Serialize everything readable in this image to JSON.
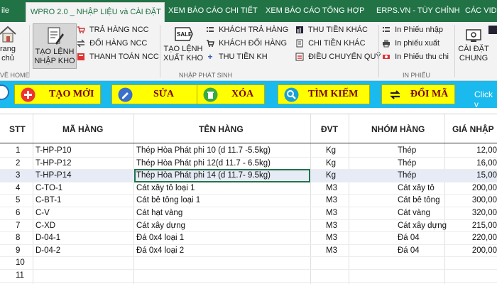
{
  "tabs": [
    {
      "label": "ile"
    },
    {
      "label": "WPRO 2.0 _ NHẬP LIỆU và CÀI ĐẶT",
      "active": true
    },
    {
      "label": "XEM BÁO CÁO CHI TIẾT"
    },
    {
      "label": "XEM BÁO CÁO TỔNG HỢP"
    },
    {
      "label": "ERPS.VN - TÙY CHỈNH"
    },
    {
      "label": "CÁC VID"
    }
  ],
  "ribbon": {
    "home": {
      "label": "rang\nchủ",
      "group": "VỀ HOME"
    },
    "tao_lenh_nhap": {
      "label": "TẠO LỆNH\nNHẬP KHO"
    },
    "tra_hang_ncc": {
      "label": "TRẢ HÀNG NCC"
    },
    "doi_hang_ncc": {
      "label": "ĐỔI HÀNG NCC"
    },
    "thanh_toan_ncc": {
      "label": "THANH TOÁN NCC"
    },
    "tao_lenh_xuat": {
      "label": "TẠO LỆNH\nXUẤT KHO"
    },
    "khach_tra_hang": {
      "label": "KHÁCH TRẢ HÀNG"
    },
    "khach_doi_hang": {
      "label": "KHÁCH ĐỔI HÀNG"
    },
    "thu_tien_kh": {
      "label": "THU TIỀN KH"
    },
    "thu_tien_khac": {
      "label": "THU TIỀN KHÁC"
    },
    "chi_tien_khac": {
      "label": "CHI TIỀN KHÁC"
    },
    "dieu_chuyen_quy": {
      "label": "ĐIỀU CHUYỂN QUỸ"
    },
    "group_nhap_phat_sinh": "NHẬP PHÁT SINH",
    "in_phieu_nhap": {
      "label": "In Phiếu nhập"
    },
    "in_phieu_xuat": {
      "label": "In phiếu xuất"
    },
    "in_phieu_thu_chi": {
      "label": "In Phiếu thu chi"
    },
    "group_in_phieu": "IN PHIẾU",
    "cai_dat_chung": {
      "label": "CÀI ĐẶT\nCHUNG"
    }
  },
  "actions": {
    "tao_moi": "TẠO MỚI",
    "sua": "SỬA",
    "xoa": "XÓA",
    "tim_kiem": "TÌM KIẾM",
    "doi_ma": "ĐỔI MÃ",
    "click_hint": "Click v"
  },
  "table": {
    "headers": {
      "stt": "STT",
      "ma_hang": "MÃ HÀNG",
      "ten_hang": "TÊN HÀNG",
      "dvt": "ĐVT",
      "nhom_hang": "NHÓM HÀNG",
      "gia_nhap": "GIÁ NHẬP"
    },
    "rows": [
      {
        "stt": "1",
        "ma": "T-HP-P10",
        "ten": "Thép Hòa Phát phi 10 (d 11.7 -5.5kg)",
        "dvt": "Kg",
        "nhom": "Thép",
        "gia": "12,00"
      },
      {
        "stt": "2",
        "ma": "T-HP-P12",
        "ten": "Thép Hòa Phát phi 12(d 11.7 - 6.5kg)",
        "dvt": "Kg",
        "nhom": "Thép",
        "gia": "16,00"
      },
      {
        "stt": "3",
        "ma": "T-HP-P14",
        "ten": "Thép Hòa Phát phi 14 (d 11.7- 9.5kg)",
        "dvt": "Kg",
        "nhom": "Thép",
        "gia": "15,00"
      },
      {
        "stt": "4",
        "ma": "C-TO-1",
        "ten": "Cát xây tô loại 1",
        "dvt": "M3",
        "nhom": "Cát xây tô",
        "gia": "200,00"
      },
      {
        "stt": "5",
        "ma": "C-BT-1",
        "ten": "Cát bê tông loại 1",
        "dvt": "M3",
        "nhom": "Cát bê tông",
        "gia": "300,00"
      },
      {
        "stt": "6",
        "ma": "C-V",
        "ten": "Cát hạt vàng",
        "dvt": "M3",
        "nhom": "Cát vàng",
        "gia": "320,00"
      },
      {
        "stt": "7",
        "ma": "C-XD",
        "ten": "Cát xây dựng",
        "dvt": "M3",
        "nhom": "Cát xây dựng",
        "gia": "215,00"
      },
      {
        "stt": "8",
        "ma": "D-04-1",
        "ten": "Đá 0x4 loại 1",
        "dvt": "M3",
        "nhom": "Đá 04",
        "gia": "220,00"
      },
      {
        "stt": "9",
        "ma": "D-04-2",
        "ten": "Đá 0x4 loại 2",
        "dvt": "M3",
        "nhom": "Đá 04",
        "gia": "200,00"
      },
      {
        "stt": "10",
        "ma": "",
        "ten": "",
        "dvt": "",
        "nhom": "",
        "gia": ""
      },
      {
        "stt": "11",
        "ma": "",
        "ten": "",
        "dvt": "",
        "nhom": "",
        "gia": ""
      }
    ],
    "selected_row": 3
  },
  "colors": {
    "ribbon_green": "#217346",
    "strip_blue": "#1abaee",
    "button_yellow": "#ffff00",
    "button_text": "#7a0000"
  }
}
